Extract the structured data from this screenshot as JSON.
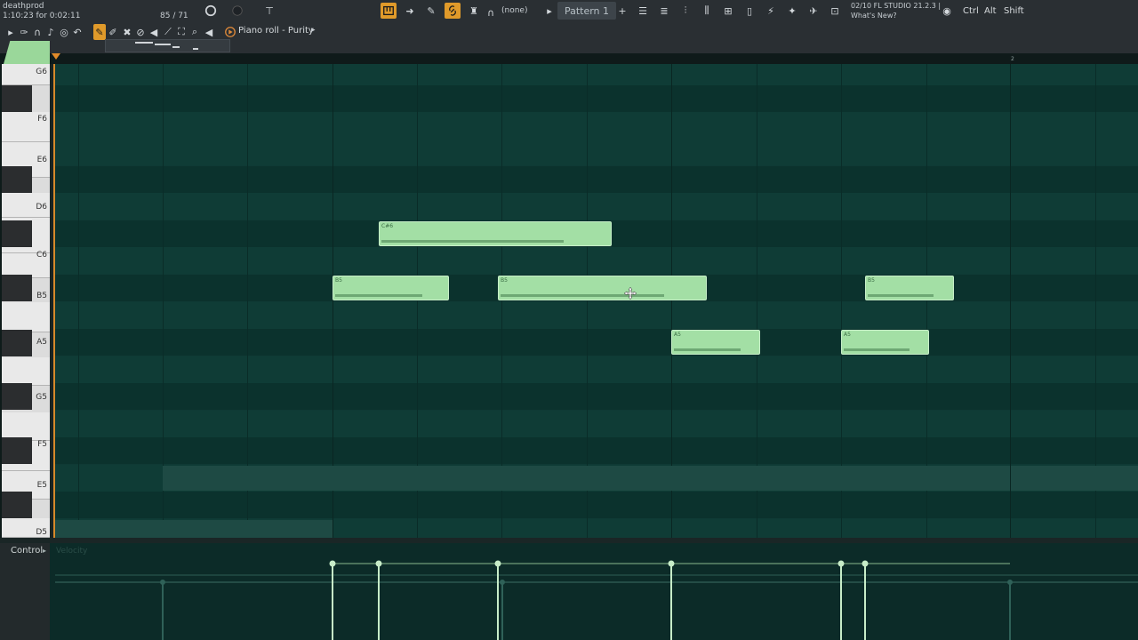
{
  "topbar": {
    "project_name": "deathprod",
    "time_info": "1:10:23 for 0:02:11",
    "cpu": "85 / 71",
    "none_label": "(none)",
    "pattern_label": "Pattern 1",
    "version_line1": "02/10  FL STUDIO 21.2.3 |",
    "version_line2": "What's New?",
    "mod_ctrl": "Ctrl",
    "mod_alt": "Alt",
    "mod_shift": "Shift"
  },
  "piano_roll": {
    "title": "Piano roll - Purity",
    "ruler_bar_2": "2"
  },
  "keyboard_labels": [
    "G6",
    "F6",
    "E6",
    "D6",
    "C6",
    "B5",
    "A5",
    "G5",
    "F5",
    "E5",
    "D5"
  ],
  "notes": [
    {
      "label": "C#6"
    },
    {
      "label": "B5"
    },
    {
      "label": "B5"
    },
    {
      "label": "B5"
    },
    {
      "label": "A5"
    },
    {
      "label": "A5"
    }
  ],
  "control": {
    "label": "Control",
    "param": "Velocity"
  },
  "colors": {
    "note_fill": "#a3dfa5",
    "grid_bg": "#0f3a35",
    "accent_orange": "#e09a2a"
  }
}
